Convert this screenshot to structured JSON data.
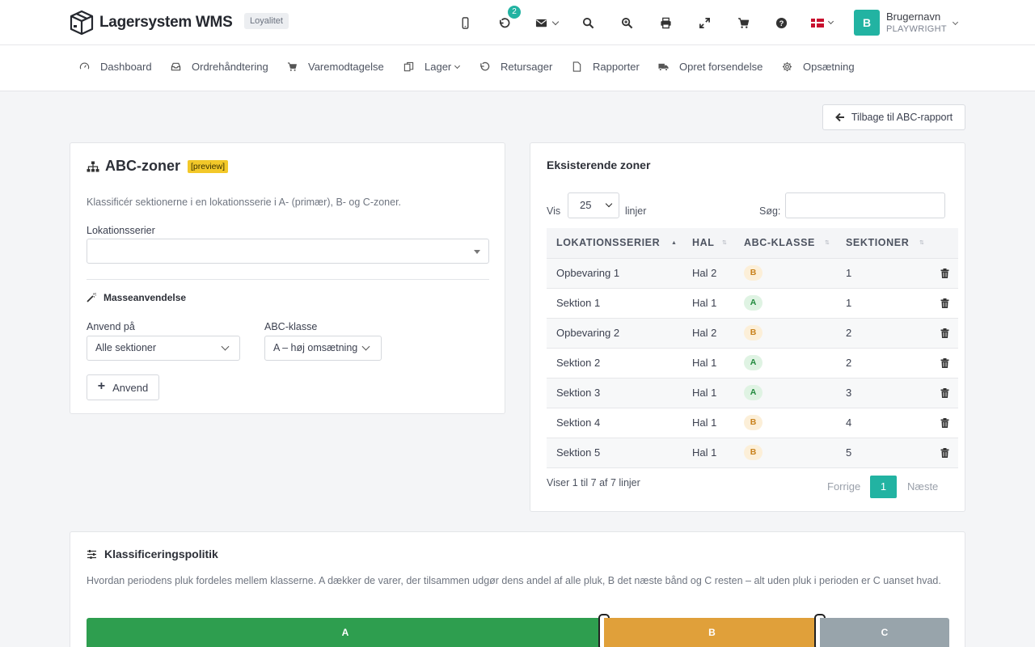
{
  "app": {
    "brand": "Lagersystem WMS",
    "tier_badge": "Loyalitet",
    "notification_count": "2"
  },
  "user": {
    "initial": "B",
    "name": "Brugernavn",
    "role": "PLAYWRIGHT"
  },
  "nav": {
    "items": [
      {
        "label": "Dashboard",
        "icon": "gauge-icon"
      },
      {
        "label": "Ordrehåndtering",
        "icon": "inbox-icon"
      },
      {
        "label": "Varemodtagelse",
        "icon": "cart-icon"
      },
      {
        "label": "Lager",
        "icon": "copy-icon"
      },
      {
        "label": "Retursager",
        "icon": "undo-icon"
      },
      {
        "label": "Rapporter",
        "icon": "file-icon"
      },
      {
        "label": "Opret forsendelse",
        "icon": "truck-icon"
      },
      {
        "label": "Opsætning",
        "icon": "gear-icon"
      }
    ]
  },
  "back_button": "Tilbage til ABC-rapport",
  "abc": {
    "title": "ABC-zoner",
    "preview_tag": "[preview]",
    "description": "Klassificér sektionerne i en lokationsserie i A- (primær), B- og C-zoner.",
    "series_label": "Lokationsserier",
    "series_value": "",
    "bulk_title": "Masseanvendelse",
    "apply_to_label": "Anvend på",
    "apply_to_value": "Alle sektioner",
    "class_label": "ABC-klasse",
    "class_value": "A – høj omsætning",
    "apply_button": "Anvend"
  },
  "zones": {
    "title": "Eksisterende zoner",
    "show_label": "Vis",
    "page_size": "25",
    "rows_label": "linjer",
    "search_label": "Søg:",
    "search_value": "",
    "columns": [
      "LOKATIONSSERIER",
      "HAL",
      "ABC-KLASSE",
      "SEKTIONER"
    ],
    "rows": [
      {
        "series": "Opbevaring 1",
        "hall": "Hal 2",
        "class": "B",
        "sections": "1"
      },
      {
        "series": "Sektion 1",
        "hall": "Hal 1",
        "class": "A",
        "sections": "1"
      },
      {
        "series": "Opbevaring 2",
        "hall": "Hal 2",
        "class": "B",
        "sections": "2"
      },
      {
        "series": "Sektion 2",
        "hall": "Hal 1",
        "class": "A",
        "sections": "2"
      },
      {
        "series": "Sektion 3",
        "hall": "Hal 1",
        "class": "A",
        "sections": "3"
      },
      {
        "series": "Sektion 4",
        "hall": "Hal 1",
        "class": "B",
        "sections": "4"
      },
      {
        "series": "Sektion 5",
        "hall": "Hal 1",
        "class": "B",
        "sections": "5"
      }
    ],
    "showing": "Viser 1 til 7 af 7 linjer",
    "prev": "Forrige",
    "current_page": "1",
    "next": "Næste"
  },
  "policy": {
    "title": "Klassificeringspolitik",
    "description": "Hvordan periodens pluk fordeles mellem klasserne. A dækker de varer, der tilsammen udgør dens andel af alle pluk, B det næste bånd og C resten – alt uden pluk i perioden er C uanset hvad.",
    "bands": [
      {
        "label": "A",
        "share": 0.6,
        "color": "#2e9e4f"
      },
      {
        "label": "B",
        "share": 0.25,
        "color": "#e0a03a"
      },
      {
        "label": "C",
        "share": 0.15,
        "color": "#98a4ab"
      }
    ]
  }
}
